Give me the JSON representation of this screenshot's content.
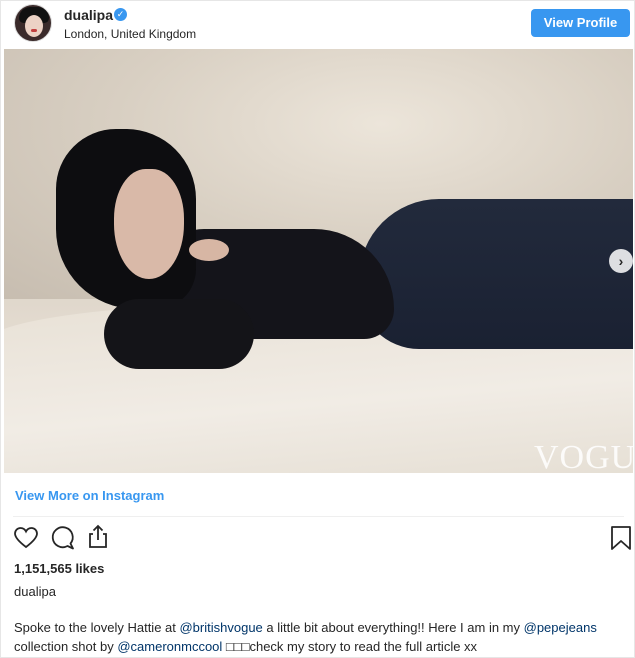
{
  "header": {
    "username": "dualipa",
    "verified_icon": "verified-check-icon",
    "location": "London, United Kingdom",
    "view_profile_label": "View Profile",
    "accent_color": "#3897f0"
  },
  "photo": {
    "watermark": "VOGUE",
    "next_icon": "chevron-right-icon",
    "next_glyph": "›"
  },
  "view_more_label": "View More on Instagram",
  "actions": {
    "like_icon": "heart-icon",
    "comment_icon": "comment-icon",
    "share_icon": "share-icon",
    "save_icon": "bookmark-icon"
  },
  "likes_text": "1,151,565 likes",
  "caption": {
    "username": "dualipa",
    "part1": "Spoke to the lovely Hattie at ",
    "mention1": "@britishvogue",
    "part2": " a little bit about everything!! Here I am in my ",
    "mention2": "@pepejeans",
    "part3": " collection shot by ",
    "mention3": "@cameronmccool",
    "part4": " □□□check my story to read the full article xx"
  }
}
